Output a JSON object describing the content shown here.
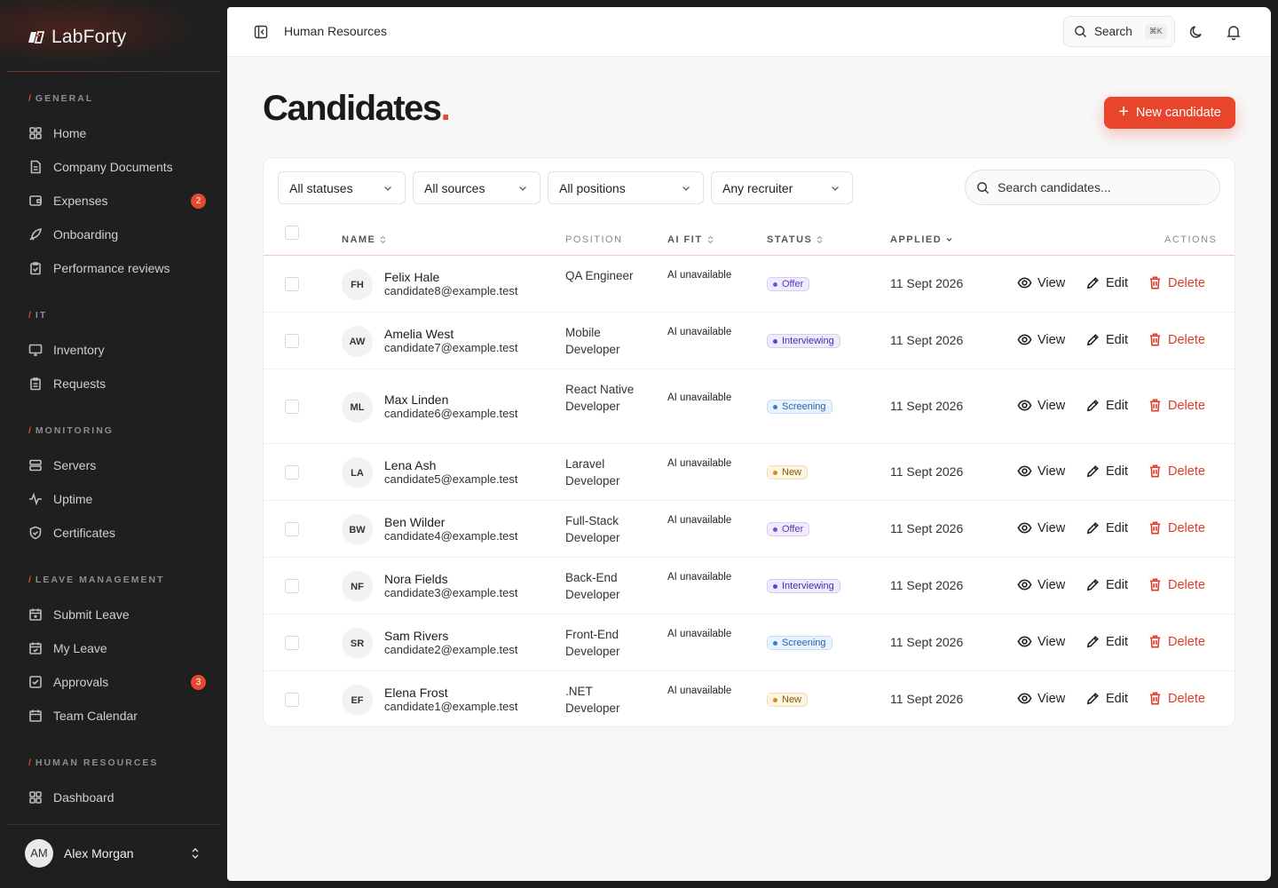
{
  "app": {
    "brand": "LabForty"
  },
  "sidebar": {
    "sections": [
      {
        "label": "GENERAL",
        "items": [
          {
            "label": "Home",
            "icon": "grid-icon"
          },
          {
            "label": "Company Documents",
            "icon": "document-icon"
          },
          {
            "label": "Expenses",
            "icon": "wallet-icon",
            "badge": "2"
          },
          {
            "label": "Onboarding",
            "icon": "rocket-icon"
          },
          {
            "label": "Performance reviews",
            "icon": "clipboard-check-icon"
          }
        ]
      },
      {
        "label": "IT",
        "items": [
          {
            "label": "Inventory",
            "icon": "monitor-icon"
          },
          {
            "label": "Requests",
            "icon": "clipboard-icon"
          }
        ]
      },
      {
        "label": "MONITORING",
        "items": [
          {
            "label": "Servers",
            "icon": "server-icon"
          },
          {
            "label": "Uptime",
            "icon": "activity-icon"
          },
          {
            "label": "Certificates",
            "icon": "shield-icon"
          }
        ]
      },
      {
        "label": "LEAVE MANAGEMENT",
        "items": [
          {
            "label": "Submit Leave",
            "icon": "calendar-plus-icon"
          },
          {
            "label": "My Leave",
            "icon": "calendar-check-icon"
          },
          {
            "label": "Approvals",
            "icon": "checkbox-icon",
            "badge": "3"
          },
          {
            "label": "Team Calendar",
            "icon": "calendar-icon"
          }
        ]
      },
      {
        "label": "HUMAN RESOURCES",
        "items": [
          {
            "label": "Dashboard",
            "icon": "grid-icon"
          }
        ]
      }
    ],
    "user": {
      "initials": "AM",
      "name": "Alex Morgan"
    }
  },
  "topbar": {
    "breadcrumb": "Human Resources",
    "search_label": "Search",
    "search_shortcut": "⌘K"
  },
  "page": {
    "title": "Candidates",
    "title_dot": ".",
    "new_button": "New candidate"
  },
  "filters": {
    "status": "All statuses",
    "source": "All sources",
    "position": "All positions",
    "recruiter": "Any recruiter",
    "search_placeholder": "Search candidates..."
  },
  "table": {
    "headers": {
      "name": "NAME",
      "position": "POSITION",
      "ai_fit": "AI FIT",
      "status": "STATUS",
      "applied": "APPLIED",
      "actions": "ACTIONS"
    },
    "actions": {
      "view": "View",
      "edit": "Edit",
      "delete": "Delete"
    },
    "rows": [
      {
        "initials": "FH",
        "name": "Felix Hale",
        "email": "candidate8@example.test",
        "position": "QA Engineer",
        "ai_fit": "AI unavailable",
        "status": "Offer",
        "applied": "11 Sept 2026"
      },
      {
        "initials": "AW",
        "name": "Amelia West",
        "email": "candidate7@example.test",
        "position": "Mobile Developer",
        "ai_fit": "AI unavailable",
        "status": "Interviewing",
        "applied": "11 Sept 2026"
      },
      {
        "initials": "ML",
        "name": "Max Linden",
        "email": "candidate6@example.test",
        "position": "React Native Developer",
        "ai_fit": "AI unavailable",
        "status": "Screening",
        "applied": "11 Sept 2026"
      },
      {
        "initials": "LA",
        "name": "Lena Ash",
        "email": "candidate5@example.test",
        "position": "Laravel Developer",
        "ai_fit": "AI unavailable",
        "status": "New",
        "applied": "11 Sept 2026"
      },
      {
        "initials": "BW",
        "name": "Ben Wilder",
        "email": "candidate4@example.test",
        "position": "Full-Stack Developer",
        "ai_fit": "AI unavailable",
        "status": "Offer",
        "applied": "11 Sept 2026"
      },
      {
        "initials": "NF",
        "name": "Nora Fields",
        "email": "candidate3@example.test",
        "position": "Back-End Developer",
        "ai_fit": "AI unavailable",
        "status": "Interviewing",
        "applied": "11 Sept 2026"
      },
      {
        "initials": "SR",
        "name": "Sam Rivers",
        "email": "candidate2@example.test",
        "position": "Front-End Developer",
        "ai_fit": "AI unavailable",
        "status": "Screening",
        "applied": "11 Sept 2026"
      },
      {
        "initials": "EF",
        "name": "Elena Frost",
        "email": "candidate1@example.test",
        "position": ".NET Developer",
        "ai_fit": "AI unavailable",
        "status": "New",
        "applied": "11 Sept 2026"
      }
    ]
  },
  "colors": {
    "accent": "#e8452c",
    "status_offer": "#7c4ddc",
    "status_interviewing": "#5b3fd6",
    "status_screening": "#2b7fd6",
    "status_new": "#d9880f"
  }
}
